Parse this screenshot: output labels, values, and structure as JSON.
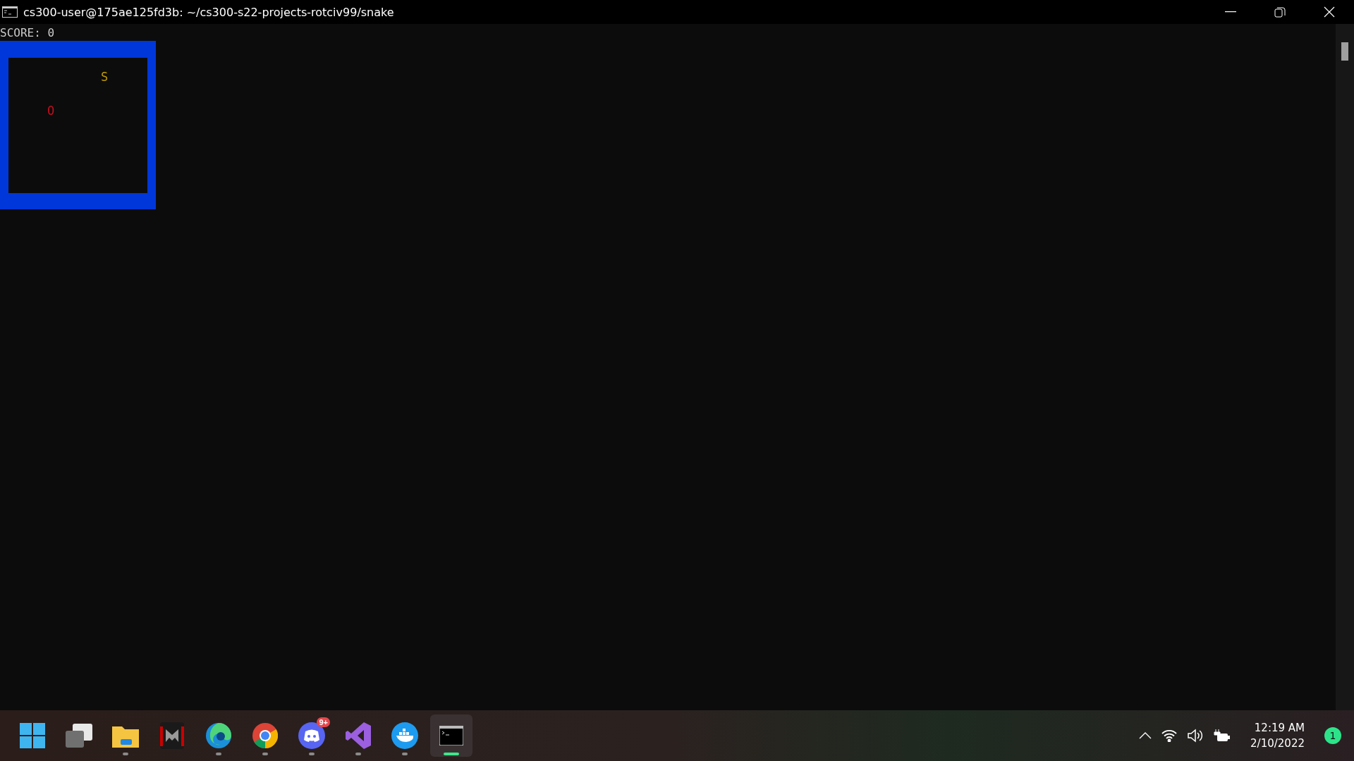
{
  "window": {
    "title": "cs300-user@175ae125fd3b: ~/cs300-s22-projects-rotciv99/snake"
  },
  "terminal": {
    "score_line": "SCORE: 0",
    "board": [
      {
        "kind": "snake",
        "glyph": "S"
      },
      {
        "kind": "food",
        "glyph": "O"
      }
    ]
  },
  "taskbar": {
    "apps": [
      {
        "kind": "start",
        "running": false,
        "active": false
      },
      {
        "kind": "task-view",
        "running": false,
        "active": false
      },
      {
        "kind": "folder",
        "running": true,
        "active": false
      },
      {
        "kind": "predator",
        "running": false,
        "active": false
      },
      {
        "kind": "edge",
        "running": true,
        "active": false
      },
      {
        "kind": "chrome",
        "running": true,
        "active": false
      },
      {
        "kind": "discord",
        "running": true,
        "active": false,
        "badge": "9+"
      },
      {
        "kind": "visual-studio",
        "running": true,
        "active": false
      },
      {
        "kind": "docker",
        "running": true,
        "active": false
      },
      {
        "kind": "terminal",
        "running": true,
        "active": true
      }
    ],
    "time": "12:19 AM",
    "date": "2/10/2022",
    "notifications": "1"
  }
}
